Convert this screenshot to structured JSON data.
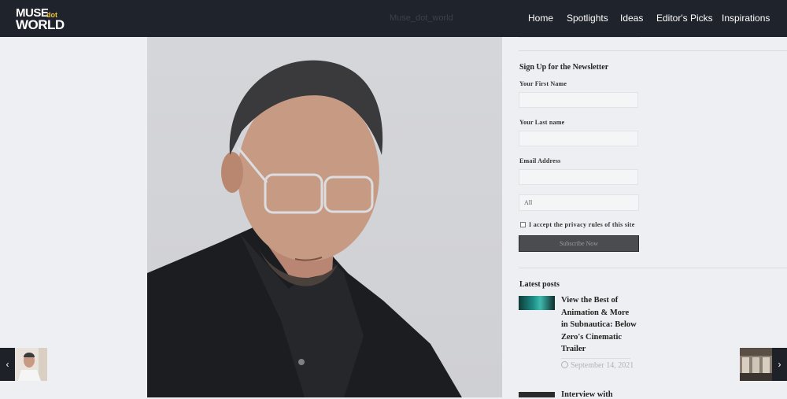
{
  "header": {
    "logo": {
      "line1": "MUSE",
      "dot": "dot",
      "line2": "WORLD"
    },
    "nav": [
      "Home",
      "Spotlights",
      "Ideas",
      "Editor's Picks",
      "Inspirations"
    ],
    "ghost_text": "Muse_dot_world"
  },
  "newsletter": {
    "heading": "Sign Up for the Newsletter",
    "first_name_label": "Your First Name",
    "last_name_label": "Your Last name",
    "email_label": "Email Address",
    "select_value": "All",
    "privacy_label": "I accept the privacy rules of this site",
    "subscribe_label": "Subscribe Now"
  },
  "latest_posts": {
    "heading": "Latest posts",
    "posts": [
      {
        "title": "View the Best of Animation & More in Subnautica: Below Zero's Cinematic Trailer",
        "date": "September 14, 2021"
      },
      {
        "title": "Interview with"
      }
    ]
  },
  "arrows": {
    "prev": "‹",
    "next": "›"
  },
  "colors": {
    "header_bg": "#1f232b",
    "page_bg": "#eeeff2",
    "logo_dot": "#f2c53d",
    "button_bg": "#4b4c50"
  }
}
